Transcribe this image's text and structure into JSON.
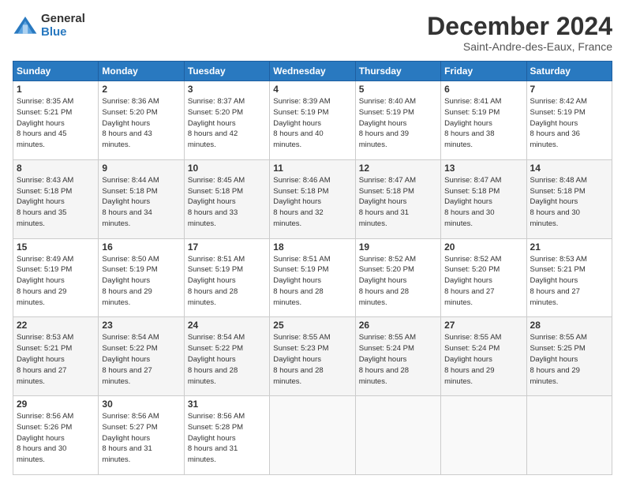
{
  "logo": {
    "general": "General",
    "blue": "Blue"
  },
  "title": "December 2024",
  "subtitle": "Saint-Andre-des-Eaux, France",
  "days": [
    "Sunday",
    "Monday",
    "Tuesday",
    "Wednesday",
    "Thursday",
    "Friday",
    "Saturday"
  ],
  "weeks": [
    [
      {
        "day": "1",
        "sunrise": "8:35 AM",
        "sunset": "5:21 PM",
        "daylight": "8 hours and 45 minutes."
      },
      {
        "day": "2",
        "sunrise": "8:36 AM",
        "sunset": "5:20 PM",
        "daylight": "8 hours and 43 minutes."
      },
      {
        "day": "3",
        "sunrise": "8:37 AM",
        "sunset": "5:20 PM",
        "daylight": "8 hours and 42 minutes."
      },
      {
        "day": "4",
        "sunrise": "8:39 AM",
        "sunset": "5:19 PM",
        "daylight": "8 hours and 40 minutes."
      },
      {
        "day": "5",
        "sunrise": "8:40 AM",
        "sunset": "5:19 PM",
        "daylight": "8 hours and 39 minutes."
      },
      {
        "day": "6",
        "sunrise": "8:41 AM",
        "sunset": "5:19 PM",
        "daylight": "8 hours and 38 minutes."
      },
      {
        "day": "7",
        "sunrise": "8:42 AM",
        "sunset": "5:19 PM",
        "daylight": "8 hours and 36 minutes."
      }
    ],
    [
      {
        "day": "8",
        "sunrise": "8:43 AM",
        "sunset": "5:18 PM",
        "daylight": "8 hours and 35 minutes."
      },
      {
        "day": "9",
        "sunrise": "8:44 AM",
        "sunset": "5:18 PM",
        "daylight": "8 hours and 34 minutes."
      },
      {
        "day": "10",
        "sunrise": "8:45 AM",
        "sunset": "5:18 PM",
        "daylight": "8 hours and 33 minutes."
      },
      {
        "day": "11",
        "sunrise": "8:46 AM",
        "sunset": "5:18 PM",
        "daylight": "8 hours and 32 minutes."
      },
      {
        "day": "12",
        "sunrise": "8:47 AM",
        "sunset": "5:18 PM",
        "daylight": "8 hours and 31 minutes."
      },
      {
        "day": "13",
        "sunrise": "8:47 AM",
        "sunset": "5:18 PM",
        "daylight": "8 hours and 30 minutes."
      },
      {
        "day": "14",
        "sunrise": "8:48 AM",
        "sunset": "5:18 PM",
        "daylight": "8 hours and 30 minutes."
      }
    ],
    [
      {
        "day": "15",
        "sunrise": "8:49 AM",
        "sunset": "5:19 PM",
        "daylight": "8 hours and 29 minutes."
      },
      {
        "day": "16",
        "sunrise": "8:50 AM",
        "sunset": "5:19 PM",
        "daylight": "8 hours and 29 minutes."
      },
      {
        "day": "17",
        "sunrise": "8:51 AM",
        "sunset": "5:19 PM",
        "daylight": "8 hours and 28 minutes."
      },
      {
        "day": "18",
        "sunrise": "8:51 AM",
        "sunset": "5:19 PM",
        "daylight": "8 hours and 28 minutes."
      },
      {
        "day": "19",
        "sunrise": "8:52 AM",
        "sunset": "5:20 PM",
        "daylight": "8 hours and 28 minutes."
      },
      {
        "day": "20",
        "sunrise": "8:52 AM",
        "sunset": "5:20 PM",
        "daylight": "8 hours and 27 minutes."
      },
      {
        "day": "21",
        "sunrise": "8:53 AM",
        "sunset": "5:21 PM",
        "daylight": "8 hours and 27 minutes."
      }
    ],
    [
      {
        "day": "22",
        "sunrise": "8:53 AM",
        "sunset": "5:21 PM",
        "daylight": "8 hours and 27 minutes."
      },
      {
        "day": "23",
        "sunrise": "8:54 AM",
        "sunset": "5:22 PM",
        "daylight": "8 hours and 27 minutes."
      },
      {
        "day": "24",
        "sunrise": "8:54 AM",
        "sunset": "5:22 PM",
        "daylight": "8 hours and 28 minutes."
      },
      {
        "day": "25",
        "sunrise": "8:55 AM",
        "sunset": "5:23 PM",
        "daylight": "8 hours and 28 minutes."
      },
      {
        "day": "26",
        "sunrise": "8:55 AM",
        "sunset": "5:24 PM",
        "daylight": "8 hours and 28 minutes."
      },
      {
        "day": "27",
        "sunrise": "8:55 AM",
        "sunset": "5:24 PM",
        "daylight": "8 hours and 29 minutes."
      },
      {
        "day": "28",
        "sunrise": "8:55 AM",
        "sunset": "5:25 PM",
        "daylight": "8 hours and 29 minutes."
      }
    ],
    [
      {
        "day": "29",
        "sunrise": "8:56 AM",
        "sunset": "5:26 PM",
        "daylight": "8 hours and 30 minutes."
      },
      {
        "day": "30",
        "sunrise": "8:56 AM",
        "sunset": "5:27 PM",
        "daylight": "8 hours and 31 minutes."
      },
      {
        "day": "31",
        "sunrise": "8:56 AM",
        "sunset": "5:28 PM",
        "daylight": "8 hours and 31 minutes."
      },
      null,
      null,
      null,
      null
    ]
  ]
}
